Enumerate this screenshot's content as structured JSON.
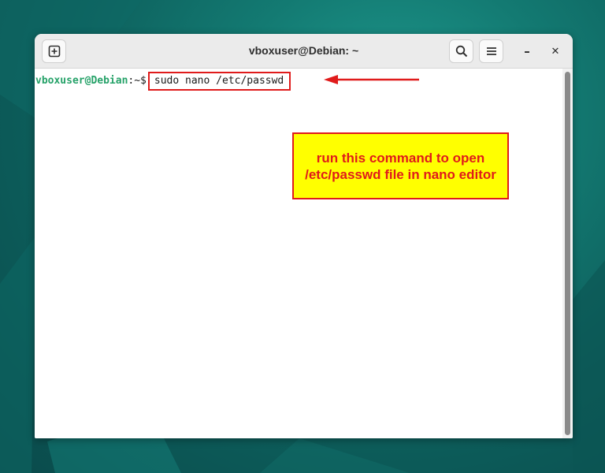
{
  "window": {
    "title": "vboxuser@Debian: ~",
    "controls": {
      "minimize": "–",
      "close": "✕"
    }
  },
  "toolbar": {
    "new_tab_icon": "new-tab-icon",
    "search_icon": "search-icon",
    "menu_icon": "hamburger-menu-icon"
  },
  "terminal": {
    "prompt_user_host": "vboxuser@Debian",
    "prompt_path": ":~$",
    "command": "sudo nano /etc/passwd"
  },
  "annotation": {
    "text": "run this command to open /etc/passwd file in nano editor",
    "arrow_color": "#e01b1b",
    "box_color": "#ffff00"
  },
  "colors": {
    "prompt_green": "#26a269",
    "highlight_red": "#e01b1b",
    "desktop_teal": "#137a72"
  }
}
